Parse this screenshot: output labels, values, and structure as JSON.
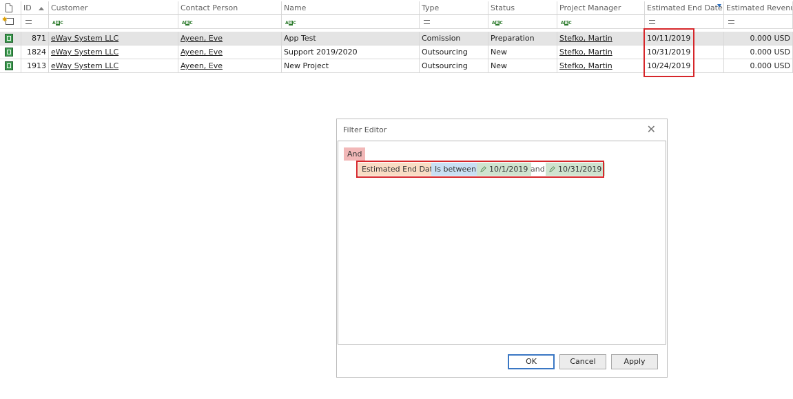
{
  "grid": {
    "columns": [
      {
        "key": "rowicon",
        "label": ""
      },
      {
        "key": "id",
        "label": "ID"
      },
      {
        "key": "customer",
        "label": "Customer"
      },
      {
        "key": "contact",
        "label": "Contact Person"
      },
      {
        "key": "name",
        "label": "Name"
      },
      {
        "key": "type",
        "label": "Type"
      },
      {
        "key": "status",
        "label": "Status"
      },
      {
        "key": "pm",
        "label": "Project Manager"
      },
      {
        "key": "end",
        "label": "Estimated End Date"
      },
      {
        "key": "rev",
        "label": "Estimated Revenue"
      }
    ],
    "sorted_column": "ID",
    "filtered_column": "Estimated End Date",
    "rows": [
      {
        "id": "871",
        "customer": "eWay System LLC",
        "contact": "Ayeen, Eve",
        "name": "App Test",
        "type": "Comission",
        "status": "Preparation",
        "pm": "Stefko, Martin",
        "end": "10/11/2019",
        "rev": "0.000 USD"
      },
      {
        "id": "1824",
        "customer": "eWay System LLC",
        "contact": "Ayeen, Eve",
        "name": "Support 2019/2020",
        "type": "Outsourcing",
        "status": "New",
        "pm": "Stefko, Martin",
        "end": "10/31/2019",
        "rev": "0.000 USD"
      },
      {
        "id": "1913",
        "customer": "eWay System LLC",
        "contact": "Ayeen, Eve",
        "name": "New Project",
        "type": "Outsourcing",
        "status": "New",
        "pm": "Stefko, Martin",
        "end": "10/24/2019",
        "rev": "0.000 USD"
      }
    ],
    "autofilter_icons": [
      "new-row-icon",
      "equals-icon",
      "abc-icon",
      "abc-icon",
      "abc-icon",
      "equals-icon",
      "abc-icon",
      "abc-icon",
      "equals-icon",
      "equals-icon"
    ]
  },
  "dialog": {
    "title": "Filter Editor",
    "close_glyph": "✕",
    "group_operator": "And",
    "condition": {
      "field": "Estimated End Date",
      "operator": "Is between",
      "value1": "10/1/2019",
      "joiner": "and",
      "value2": "10/31/2019"
    },
    "buttons": {
      "ok": "OK",
      "cancel": "Cancel",
      "apply": "Apply"
    }
  },
  "colors": {
    "highlight": "#d6262a",
    "group_token": "#f2b8b8",
    "field_token": "#f9dcc4",
    "operator_token": "#c9dff3",
    "value_token": "#cfe3cf",
    "record_icon": "#3d9a4f"
  }
}
